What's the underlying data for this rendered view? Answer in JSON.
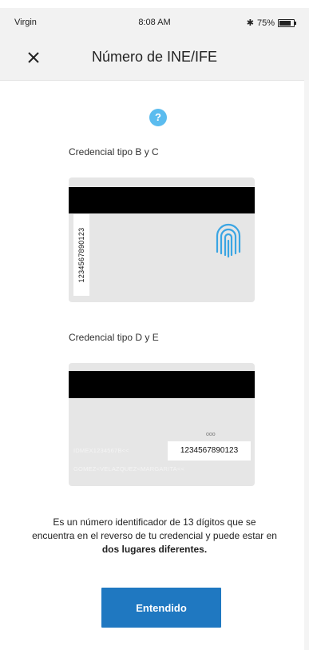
{
  "status_bar": {
    "carrier": "Virgin",
    "time": "8:08 AM",
    "battery": "75%",
    "bluetooth_icon": "bluetooth-icon",
    "battery_icon": "battery-icon"
  },
  "header": {
    "close_icon": "close-icon",
    "title": "Número de INE/IFE"
  },
  "help_icon": {
    "name": "help-icon",
    "glyph": "?",
    "color": "#5bbcef"
  },
  "cards": [
    {
      "label": "Credencial tipo B y C",
      "number": "1234567890123",
      "icon": "fingerprint-icon"
    },
    {
      "label": "Credencial tipo D y E",
      "number": "1234567890123",
      "small_mark": "ooo",
      "mrz_line_1": "IDMEX1234567B<<",
      "mrz_line_2": "GOMEZ<VELAZQUEZ<MARGARITA<<"
    }
  ],
  "description": {
    "text_before": "Es un número identificador de 13 dígitos que se encuentra en el reverso de tu credencial y puede estar en ",
    "text_bold": "dos lugares diferentes."
  },
  "button": {
    "label": "Entendido",
    "color": "#1f78c1"
  }
}
